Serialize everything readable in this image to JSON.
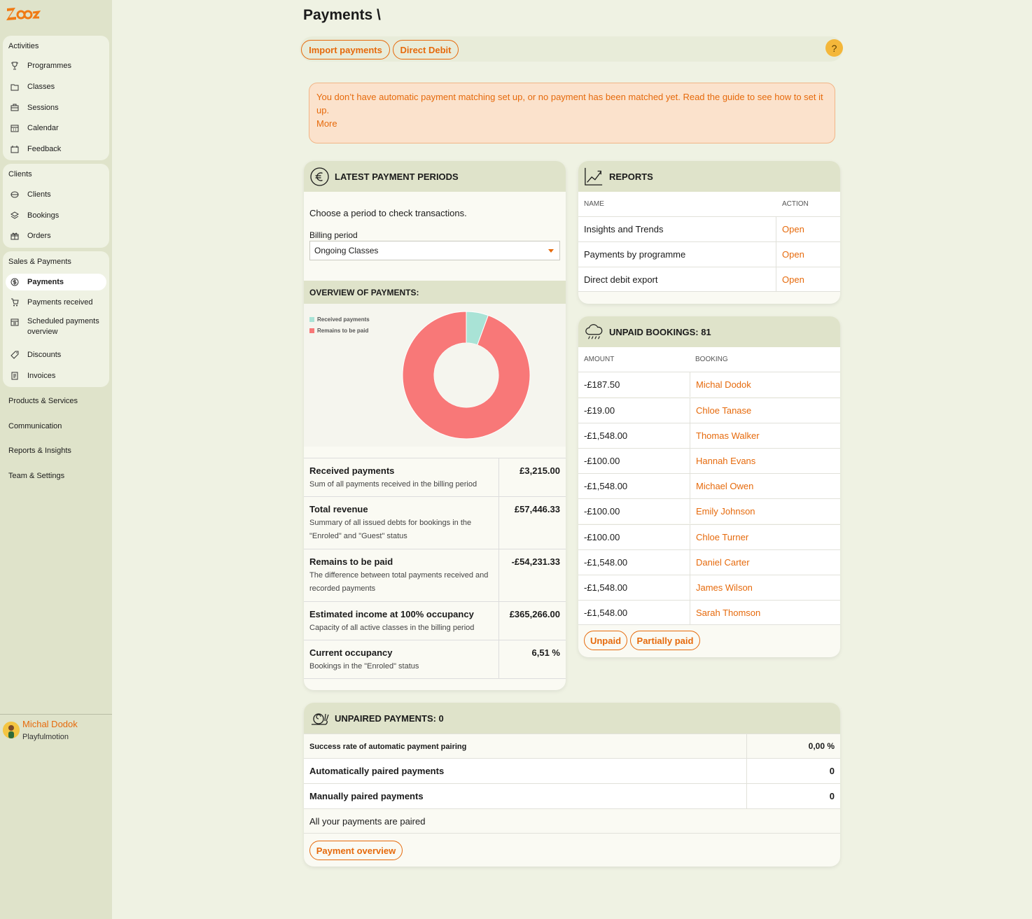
{
  "app": {
    "logo_text": "Zooza",
    "brand_color": "#e66a0c"
  },
  "sidebar": {
    "activities": {
      "heading": "Activities",
      "items": [
        {
          "label": "Programmes",
          "icon": "trophy-icon"
        },
        {
          "label": "Classes",
          "icon": "folder-icon"
        },
        {
          "label": "Sessions",
          "icon": "briefcase-icon"
        },
        {
          "label": "Calendar",
          "icon": "calendar-icon"
        },
        {
          "label": "Feedback",
          "icon": "feedback-icon"
        }
      ]
    },
    "clients": {
      "heading": "Clients",
      "items": [
        {
          "label": "Clients",
          "icon": "clients-icon"
        },
        {
          "label": "Bookings",
          "icon": "layers-icon"
        },
        {
          "label": "Orders",
          "icon": "gift-icon"
        }
      ]
    },
    "sales": {
      "heading": "Sales & Payments",
      "items": [
        {
          "label": "Payments",
          "icon": "currency-icon",
          "active": true
        },
        {
          "label": "Payments received",
          "icon": "cart-icon"
        },
        {
          "label": "Scheduled payments overview",
          "icon": "schedule-icon"
        },
        {
          "label": "Discounts",
          "icon": "tag-icon"
        },
        {
          "label": "Invoices",
          "icon": "invoice-icon"
        }
      ]
    },
    "sections": [
      "Products & Services",
      "Communication",
      "Reports & Insights",
      "Team & Settings"
    ],
    "user": {
      "name": "Michal Dodok",
      "org": "Playfulmotion"
    }
  },
  "header": {
    "title": "Payments \\",
    "buttons": {
      "import": "Import payments",
      "direct_debit": "Direct Debit"
    },
    "help": "?"
  },
  "alert": {
    "text": "You don’t have automatic payment matching set up, or no payment has been matched yet. Read the guide to see how to set it up.",
    "more": "More"
  },
  "periods": {
    "title": "LATEST PAYMENT PERIODS",
    "intro": "Choose a period to check transactions.",
    "billing_label": "Billing period",
    "billing_value": "Ongoing Classes",
    "overview_title": "OVERVIEW OF PAYMENTS:",
    "stats": [
      {
        "title": "Received payments",
        "desc": "Sum of all payments received in the billing period",
        "value": "£3,215.00"
      },
      {
        "title": "Total revenue",
        "desc": "Summary of all issued debts for bookings in the \"Enroled\" and \"Guest\" status",
        "value": "£57,446.33"
      },
      {
        "title": "Remains to be paid",
        "desc": "The difference between total payments received and recorded payments",
        "value": "-£54,231.33"
      },
      {
        "title": "Estimated income at 100% occupancy",
        "desc": "Capacity of all active classes in the billing period",
        "value": "£365,266.00"
      },
      {
        "title": "Current occupancy",
        "desc": "Bookings in the \"Enroled\" status",
        "value": "6,51 %"
      }
    ]
  },
  "chart_data": {
    "type": "pie",
    "categories": [
      "Received payments",
      "Remains to be paid"
    ],
    "values": [
      3215.0,
      54231.33
    ],
    "colors": [
      "#a9e3d6",
      "#f87878"
    ],
    "donut": true,
    "legend_position": "top-left"
  },
  "reports": {
    "title": "REPORTS",
    "col_name": "NAME",
    "col_action": "ACTION",
    "rows": [
      {
        "name": "Insights and Trends",
        "action": "Open"
      },
      {
        "name": "Payments by programme",
        "action": "Open"
      },
      {
        "name": "Direct debit export",
        "action": "Open"
      }
    ]
  },
  "unpaid": {
    "title": "UNPAID BOOKINGS: 81",
    "col_amount": "AMOUNT",
    "col_booking": "BOOKING",
    "rows": [
      {
        "amount": "-£187.50",
        "name": "Michal Dodok"
      },
      {
        "amount": "-£19.00",
        "name": "Chloe Tanase"
      },
      {
        "amount": "-£1,548.00",
        "name": "Thomas Walker"
      },
      {
        "amount": "-£100.00",
        "name": "Hannah Evans"
      },
      {
        "amount": "-£1,548.00",
        "name": "Michael Owen"
      },
      {
        "amount": "-£100.00",
        "name": "Emily Johnson"
      },
      {
        "amount": "-£100.00",
        "name": "Chloe Turner"
      },
      {
        "amount": "-£1,548.00",
        "name": "Daniel Carter"
      },
      {
        "amount": "-£1,548.00",
        "name": "James Wilson"
      },
      {
        "amount": "-£1,548.00",
        "name": "Sarah Thomson"
      }
    ],
    "buttons": {
      "unpaid": "Unpaid",
      "partial": "Partially paid"
    }
  },
  "unpaired": {
    "title": "UNPAIRED PAYMENTS: 0",
    "rows": [
      {
        "name": "Success rate of automatic payment pairing",
        "value": "0,00 %"
      },
      {
        "name": "Automatically paired payments",
        "value": "0"
      },
      {
        "name": "Manually paired payments",
        "value": "0"
      }
    ],
    "note": "All your payments are paired",
    "button": "Payment overview"
  }
}
